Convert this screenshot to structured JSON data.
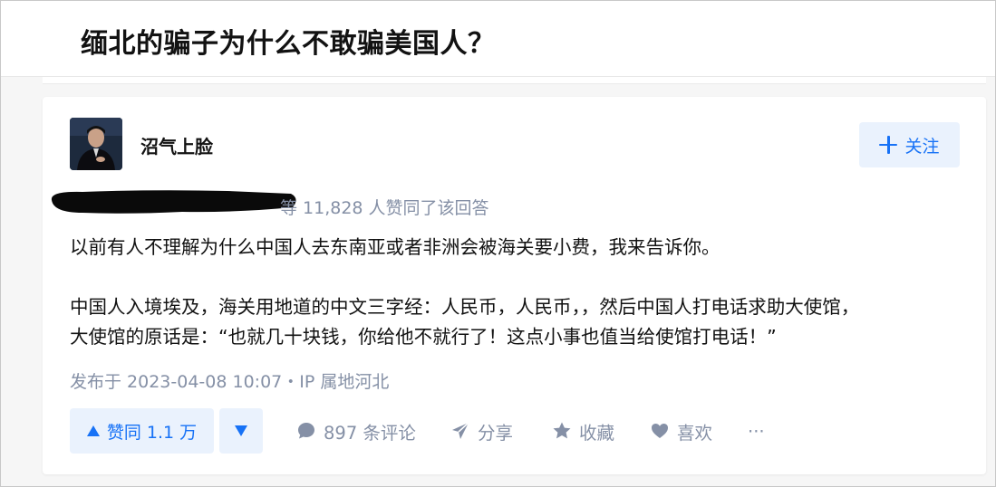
{
  "question": {
    "title": "缅北的骗子为什么不敢骗美国人？"
  },
  "author": {
    "name": "沼气上脸",
    "follow_label": "关注"
  },
  "answer": {
    "votes_text": "等 11,828 人赞同了该回答",
    "paragraphs": [
      "以前有人不理解为什么中国人去东南亚或者非洲会被海关要小费，我来告诉你。",
      "中国人入境埃及，海关用地道的中文三字经：人民币，人民币，，然后中国人打电话求助大使馆，",
      "大使馆的原话是：“也就几十块钱，你给他不就行了！这点小事也值当给使馆打电话！”"
    ],
    "meta": "发布于 2023-04-08 10:07・IP 属地河北"
  },
  "actions": {
    "upvote_label": "赞同 1.1 万",
    "comments_label": "897 条评论",
    "share_label": "分享",
    "collect_label": "收藏",
    "like_label": "喜欢",
    "more_label": "···"
  },
  "colors": {
    "brand": "#1772f6",
    "brand_bg": "#eaf2fd",
    "meta_gray": "#8590a6",
    "text": "#121212"
  }
}
